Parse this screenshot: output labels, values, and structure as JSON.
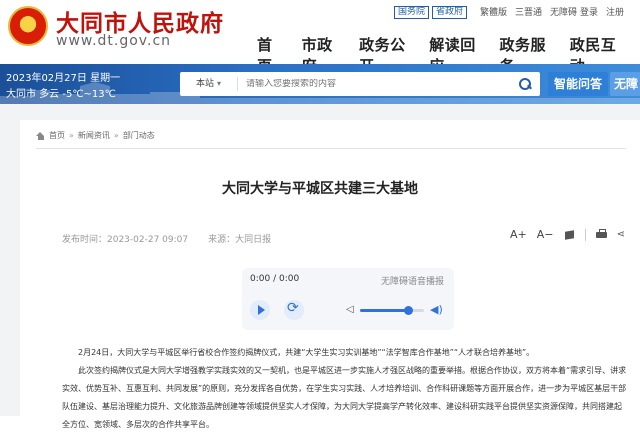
{
  "header": {
    "site_title": "大同市人民政府",
    "site_url": "www.dt.gov.cn",
    "top_links": [
      "国务院",
      "省政府"
    ],
    "lang_links": [
      "繁體版",
      "三晋通",
      "无障碍"
    ],
    "user_links": [
      "登录",
      "注册"
    ],
    "nav": [
      "首页",
      "市政府",
      "政务公开",
      "解读回应",
      "政务服务",
      "政民互动"
    ]
  },
  "banner": {
    "date": "2023年02月27日 星期一",
    "weather": "大同市 多云 -5℃~13℃",
    "search_scope": "本站",
    "search_placeholder": "请输入您要搜索的内容",
    "qa_button": "智能问答",
    "wza_button": "无障"
  },
  "breadcrumb": [
    "首页",
    "新闻资讯",
    "部门动态"
  ],
  "article": {
    "title": "大同大学与平城区共建三大基地",
    "published": "发布时间：2023-02-27 09:07",
    "source": "来源：大同日报",
    "tools": {
      "font_up": "A+",
      "font_down": "A−"
    },
    "paragraphs": [
      "2月24日，大同大学与平城区举行省校合作签约揭牌仪式，共建“大学生实习实训基地”“法学智库合作基地”“人才联合培养基地”。",
      "此次签约揭牌仪式是大同大学增强教学实践实效的又一契机，也是平城区进一步实施人才强区战略的重要举措。根据合作协议，双方将本着“需求引导、讲求实效、优势互补、互惠互利、共同发展”的原则，充分发挥各自优势，在学生实习实践、人才培养培训、合作科研课题等方面开展合作，进一步为平城区基层干部队伍建设、基层治理能力提升、文化旅游品牌创建等领域提供坚实人才保障，为大同大学提高学产转化效率、建设科研实践平台提供坚实资源保障，共同搭建起全方位、宽领域、多层次的合作共享平台。"
    ]
  },
  "player": {
    "time": "0:00 / 0:00",
    "title": "无障碍语音播报",
    "volume": 0.75
  },
  "colors": {
    "brand_red": "#c0110b",
    "banner_blue": "#1b4f98",
    "accent_blue": "#2f73d9"
  }
}
